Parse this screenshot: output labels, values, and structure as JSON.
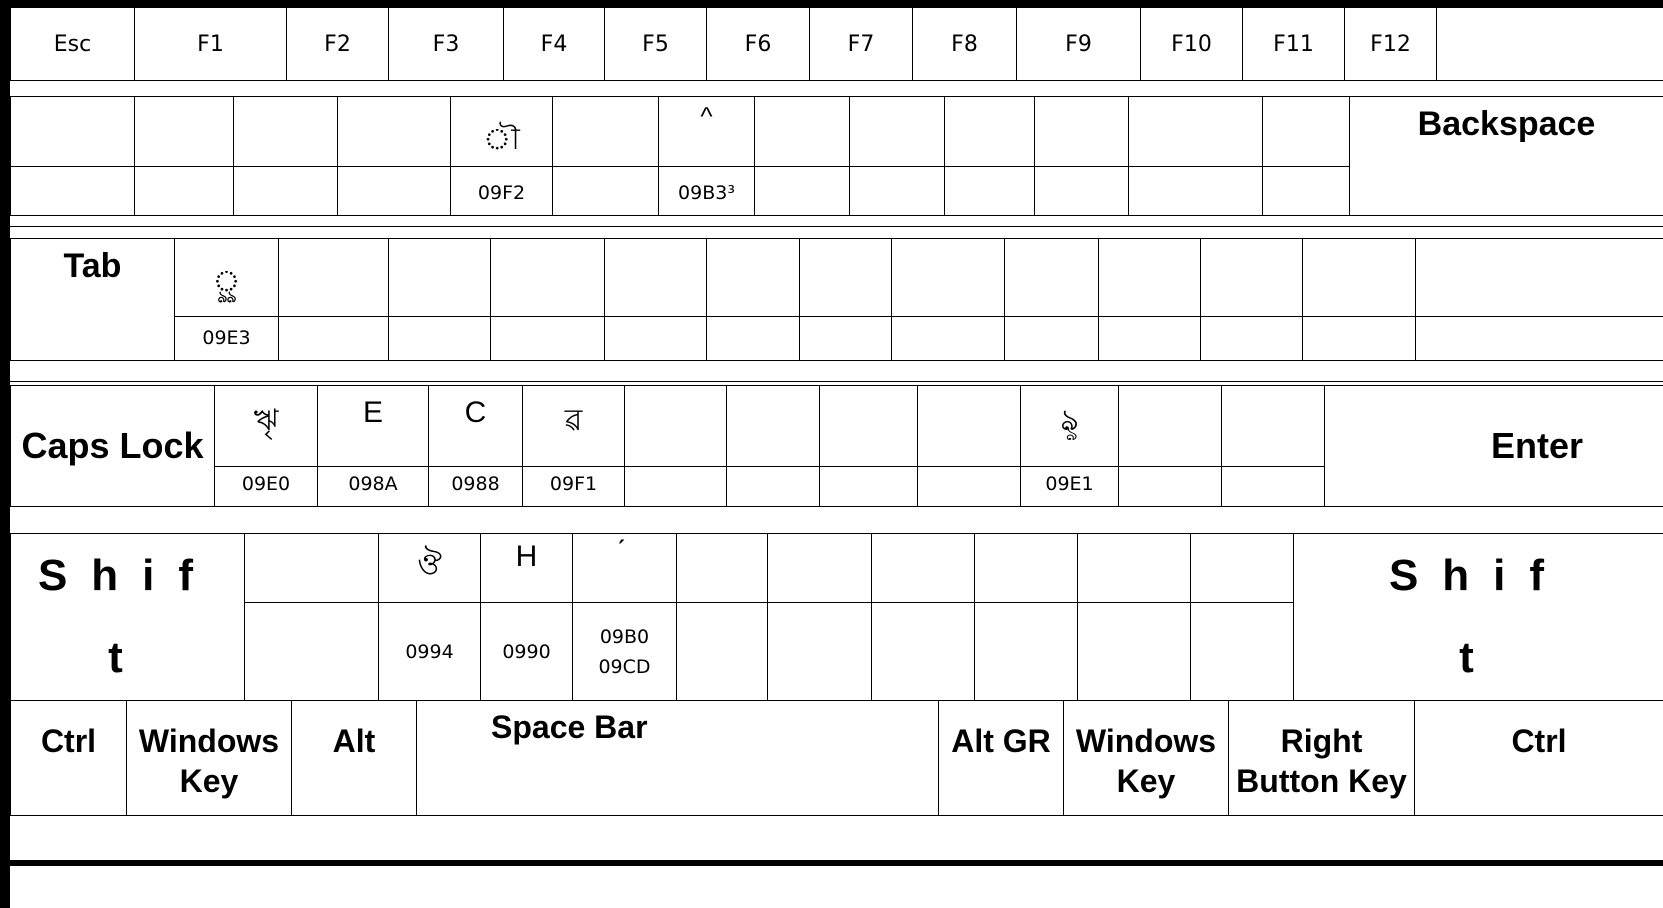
{
  "function_row": [
    "Esc",
    "F1",
    "F2",
    "F3",
    "F4",
    "F5",
    "F6",
    "F7",
    "F8",
    "F9",
    "F10",
    "F11",
    "F12",
    ""
  ],
  "number_row": {
    "glyphs": [
      "",
      "",
      "",
      "",
      "ৗ",
      "",
      "^",
      "",
      "",
      "",
      "",
      "",
      "",
      ""
    ],
    "codes": [
      "",
      "",
      "",
      "",
      "09F2",
      "",
      "09B3³",
      "",
      "",
      "",
      "",
      "",
      ""
    ],
    "backspace": "Backspace"
  },
  "tab_row": {
    "tab": "Tab",
    "glyphs": [
      "ৣ",
      "",
      "",
      "",
      "",
      "",
      "",
      "",
      "",
      "",
      "",
      "",
      "",
      ""
    ],
    "codes": [
      "09E3",
      "",
      "",
      "",
      "",
      "",
      "",
      "",
      "",
      "",
      "",
      "",
      "",
      ""
    ]
  },
  "caps_row": {
    "caps": "Caps Lock",
    "glyphs": [
      "ৠ",
      "E",
      "C",
      "ৱ",
      "",
      "",
      "",
      "",
      "ৡ",
      "",
      "",
      ""
    ],
    "codes": [
      "09E0",
      "098A",
      "0988",
      "09F1",
      "",
      "",
      "",
      "",
      "09E1",
      "",
      "",
      ""
    ],
    "enter": "Enter"
  },
  "shift_row": {
    "left_shift": "Shift",
    "right_shift": "Shift",
    "glyphs": [
      "",
      "ঔ",
      "H",
      "́",
      "",
      "",
      "",
      "",
      "",
      "",
      "",
      ""
    ],
    "codes": [
      "",
      "0994",
      "0990",
      "09B0\n09CD",
      "",
      "",
      "",
      "",
      "",
      "",
      "",
      ""
    ]
  },
  "bottom_row": [
    "Ctrl",
    "Windows\nKey",
    "Alt",
    "Space Bar",
    "Alt GR",
    "Windows\nKey",
    "Right\nButton Key",
    "Ctrl"
  ]
}
